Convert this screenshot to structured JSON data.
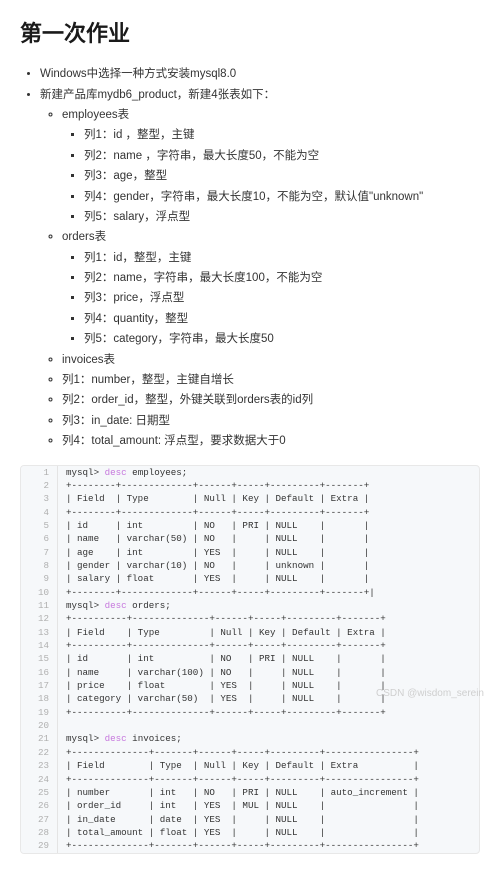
{
  "title": "第一次作业",
  "bullets": {
    "top": [
      "Windows中选择一种方式安装mysql8.0",
      "新建产品库mydb6_product，新建4张表如下："
    ],
    "employees_header": "employees表",
    "employees_cols": [
      "列1：id ，整型，主键",
      "列2：name ，字符串，最大长度50，不能为空",
      "列3：age，整型",
      "列4：gender，字符串，最大长度10，不能为空，默认值\"unknown\"",
      "列5：salary，浮点型"
    ],
    "orders_header": "orders表",
    "orders_cols": [
      "列1：id，整型，主键",
      "列2：name，字符串，最大长度100，不能为空",
      "列3：price，浮点型",
      "列4：quantity，整型",
      "列5：category，字符串，最大长度50"
    ],
    "invoices_header": "invoices表",
    "invoices_cols": [
      "列1：number，整型，主键自增长",
      "列2：order_id，整型，外键关联到orders表的id列",
      "列3：in_date: 日期型",
      "列4：total_amount: 浮点型，要求数据大于0"
    ]
  },
  "code_lines": [
    "mysql> desc employees;",
    "+--------+-------------+------+-----+---------+-------+",
    "| Field  | Type        | Null | Key | Default | Extra |",
    "+--------+-------------+------+-----+---------+-------+",
    "| id     | int         | NO   | PRI | NULL    |       |",
    "| name   | varchar(50) | NO   |     | NULL    |       |",
    "| age    | int         | YES  |     | NULL    |       |",
    "| gender | varchar(10) | NO   |     | unknown |       |",
    "| salary | float       | YES  |     | NULL    |       |",
    "+--------+-------------+------+-----+---------+-------+|",
    "mysql> desc orders;",
    "+----------+--------------+------+-----+---------+-------+",
    "| Field    | Type         | Null | Key | Default | Extra |",
    "+----------+--------------+------+-----+---------+-------+",
    "| id       | int          | NO   | PRI | NULL    |       |",
    "| name     | varchar(100) | NO   |     | NULL    |       |",
    "| price    | float        | YES  |     | NULL    |       |",
    "| category | varchar(50)  | YES  |     | NULL    |       |",
    "+----------+--------------+------+-----+---------+-------+",
    "",
    "mysql> desc invoices;",
    "+--------------+-------+------+-----+---------+----------------+",
    "| Field        | Type  | Null | Key | Default | Extra          |",
    "+--------------+-------+------+-----+---------+----------------+",
    "| number       | int   | NO   | PRI | NULL    | auto_increment |",
    "| order_id     | int   | YES  | MUL | NULL    |                |",
    "| in_date      | date  | YES  |     | NULL    |                |",
    "| total_amount | float | YES  |     | NULL    |                |",
    "+--------------+-------+------+-----+---------+----------------+"
  ],
  "watermark": "CSDN @wisdom_serein"
}
